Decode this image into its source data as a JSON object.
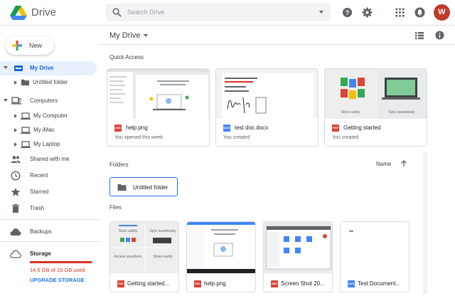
{
  "header": {
    "app_title": "Drive",
    "search_placeholder": "Search Drive",
    "avatar_letter": "W",
    "icons": [
      "help-icon",
      "settings-icon",
      "apps-grid-icon",
      "notifications-icon"
    ]
  },
  "sidebar": {
    "new_label": "New",
    "my_drive": "My Drive",
    "untitled_folder": "Untitled folder",
    "computers": "Computers",
    "my_computer": "My Computer",
    "my_imac": "My iMac",
    "my_laptop": "My Laptop",
    "shared": "Shared with me",
    "recent": "Recent",
    "starred": "Starred",
    "trash": "Trash",
    "backups": "Backups",
    "storage": "Storage",
    "storage_used": "14.5 GB of 15 GB used",
    "storage_fraction": 0.967,
    "upgrade": "UPGRADE STORAGE"
  },
  "main": {
    "breadcrumb": "My Drive",
    "quick_access_title": "Quick Access",
    "quick_access": [
      {
        "name": "help.png",
        "subtitle": "You opened this week",
        "type": "image"
      },
      {
        "name": "test doc.docx",
        "subtitle": "You created",
        "type": "doc"
      },
      {
        "name": "Getting started",
        "subtitle": "You created",
        "type": "pdf"
      }
    ],
    "thumb_texts": {
      "store_safely": "Store safely",
      "sync_seamlessly": "Sync seamlessly",
      "access_anywhere": "Access anywhere",
      "share_easily": "Share easily"
    },
    "folders_title": "Folders",
    "sort_label": "Name",
    "folders": [
      {
        "name": "Untitled folder"
      }
    ],
    "files_title": "Files",
    "files": [
      {
        "name": "Getting started...",
        "type": "pdf"
      },
      {
        "name": "help.png",
        "type": "image"
      },
      {
        "name": "Screen Shot 20...",
        "type": "image"
      },
      {
        "name": "Test Document...",
        "type": "doc"
      }
    ]
  },
  "colors": {
    "accent": "#1a73e8",
    "active_bg": "#e8f0fe",
    "pdf_red": "#db4437",
    "doc_blue": "#4285f4",
    "storage_red": "#d93025",
    "avatar_bg": "#c0392b"
  }
}
